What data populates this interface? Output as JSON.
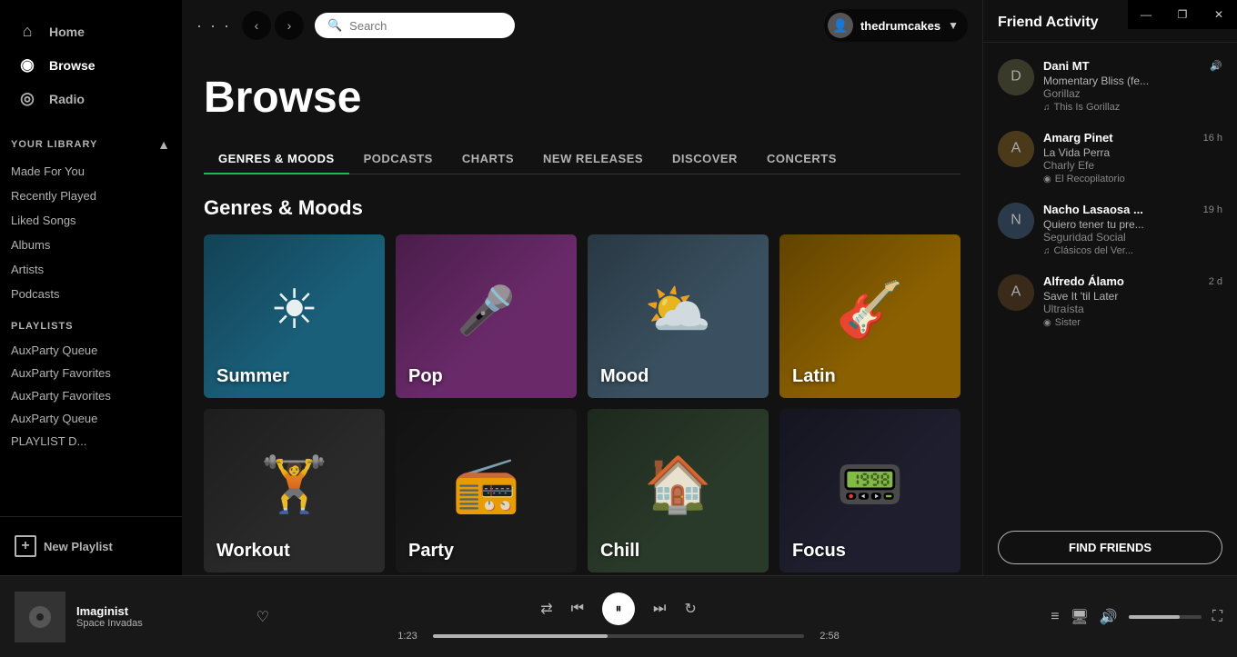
{
  "titlebar": {
    "minimize": "—",
    "maximize": "❐",
    "close": "✕"
  },
  "sidebar": {
    "dots_label": "···",
    "nav": [
      {
        "id": "home",
        "label": "Home",
        "icon": "⌂"
      },
      {
        "id": "browse",
        "label": "Browse",
        "icon": "◉",
        "active": true
      },
      {
        "id": "radio",
        "label": "Radio",
        "icon": "◎"
      }
    ],
    "library_section": "YOUR LIBRARY",
    "library_items": [
      {
        "id": "made-for-you",
        "label": "Made For You"
      },
      {
        "id": "recently-played",
        "label": "Recently Played"
      },
      {
        "id": "liked-songs",
        "label": "Liked Songs"
      },
      {
        "id": "albums",
        "label": "Albums"
      },
      {
        "id": "artists",
        "label": "Artists"
      },
      {
        "id": "podcasts",
        "label": "Podcasts"
      }
    ],
    "playlists_section": "PLAYLISTS",
    "playlist_items": [
      {
        "id": "auxparty-queue-1",
        "label": "AuxParty Queue"
      },
      {
        "id": "auxparty-favorites-1",
        "label": "AuxParty Favorites"
      },
      {
        "id": "auxparty-favorites-2",
        "label": "AuxParty Favorites"
      },
      {
        "id": "auxparty-queue-2",
        "label": "AuxParty Queue"
      },
      {
        "id": "playlist-d",
        "label": "PLAYLIST D..."
      }
    ],
    "new_playlist": "New Playlist"
  },
  "topnav": {
    "search_placeholder": "Search",
    "username": "thedrumcakes"
  },
  "browse": {
    "title": "Browse",
    "tabs": [
      {
        "id": "genres-moods",
        "label": "GENRES & MOODS",
        "active": true
      },
      {
        "id": "podcasts",
        "label": "PODCASTS"
      },
      {
        "id": "charts",
        "label": "CHARTS"
      },
      {
        "id": "new-releases",
        "label": "NEW RELEASES"
      },
      {
        "id": "discover",
        "label": "DISCOVER"
      },
      {
        "id": "concerts",
        "label": "CONCERTS"
      }
    ],
    "section_title": "Genres & Moods",
    "genre_cards_row1": [
      {
        "id": "summer",
        "label": "Summer",
        "icon": "☀",
        "color": "#1a5f7a"
      },
      {
        "id": "pop",
        "label": "Pop",
        "icon": "🎤",
        "color": "#7a3a7a"
      },
      {
        "id": "mood",
        "label": "Mood",
        "icon": "⛅",
        "color": "#3a5a7a"
      },
      {
        "id": "latin",
        "label": "Latin",
        "icon": "🎸",
        "color": "#8b6914"
      }
    ],
    "genre_cards_row2": [
      {
        "id": "workout",
        "label": "Workout",
        "icon": "🏋",
        "color": "#2a2a2a"
      },
      {
        "id": "party",
        "label": "Party",
        "icon": "📻",
        "color": "#1a1a1a"
      },
      {
        "id": "chill",
        "label": "Chill",
        "icon": "🏠",
        "color": "#2a3a2a"
      },
      {
        "id": "focus",
        "label": "Focus",
        "icon": "📟",
        "color": "#1e1e2e"
      }
    ]
  },
  "friend_activity": {
    "header": "Friend Activity",
    "friends": [
      {
        "id": "dani-mt",
        "name": "Dani MT",
        "track": "Momentary Bliss (fe...",
        "artist": "Gorillaz",
        "playlist": "This Is Gorillaz",
        "time": "",
        "playing": true
      },
      {
        "id": "amarg-pinet",
        "name": "Amarg Pinet",
        "track": "La Vida Perra",
        "artist": "Charly Efe",
        "playlist": "El Recopilatorio",
        "time": "16 h",
        "playing": false
      },
      {
        "id": "nacho-lasaosa",
        "name": "Nacho Lasaosa ...",
        "track": "Quiero tener tu pre...",
        "artist": "Seguridad Social",
        "playlist": "Clásicos del Ver...",
        "time": "19 h",
        "playing": false
      },
      {
        "id": "alfredo-alamo",
        "name": "Alfredo Álamo",
        "track": "Save It 'til Later",
        "artist": "Ultraísta",
        "playlist": "Sister",
        "time": "2 d",
        "playing": false
      }
    ],
    "find_friends_label": "FIND FRIENDS"
  },
  "player": {
    "track_name": "Imaginist",
    "artist_name": "Space Invadas",
    "current_time": "1:23",
    "total_time": "2:58",
    "progress_percent": 47
  }
}
